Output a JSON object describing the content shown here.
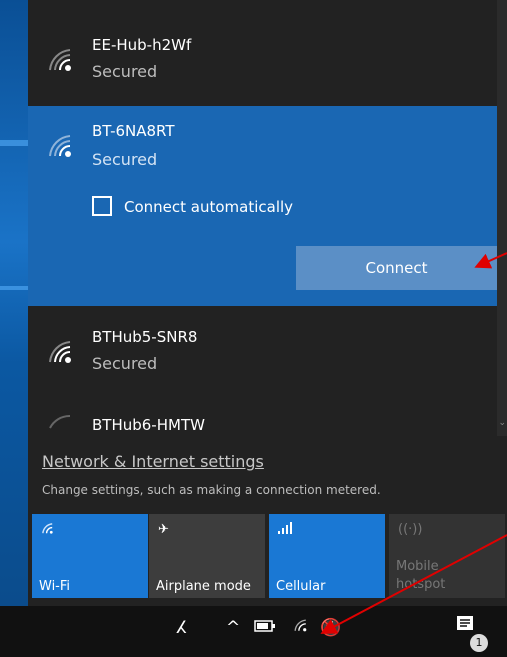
{
  "networks": [
    {
      "name": "EE-Hub-h2Wf",
      "status": "Secured"
    },
    {
      "name": "BT-6NA8RT",
      "status": "Secured"
    },
    {
      "name": "BTHub5-SNR8",
      "status": "Secured"
    },
    {
      "name": "BTHub6-HMTW",
      "status": ""
    }
  ],
  "selected": {
    "connect_automatically_label": "Connect automatically",
    "connect_automatically_checked": false,
    "connect_button": "Connect"
  },
  "settings": {
    "link": "Network & Internet settings",
    "description": "Change settings, such as making a connection metered."
  },
  "quick_actions": [
    {
      "label": "Wi-Fi",
      "icon": "wifi-icon",
      "state": "on"
    },
    {
      "label": "Airplane mode",
      "icon": "airplane-icon",
      "state": "off"
    },
    {
      "label": "Cellular",
      "icon": "cellular-icon",
      "state": "on"
    },
    {
      "label": "Mobile hotspot",
      "icon": "hotspot-icon",
      "state": "disabled"
    }
  ],
  "taskbar": {
    "notification_count": "1",
    "icons": [
      "people-icon",
      "chevron-up-icon",
      "battery-icon",
      "wifi-icon",
      "volume-muted-icon",
      "action-center-icon"
    ]
  },
  "colors": {
    "accent": "#1a78d4",
    "selected_bg": "#1a67b3",
    "flyout_bg": "#222222",
    "annotation_arrow": "#e00000"
  }
}
